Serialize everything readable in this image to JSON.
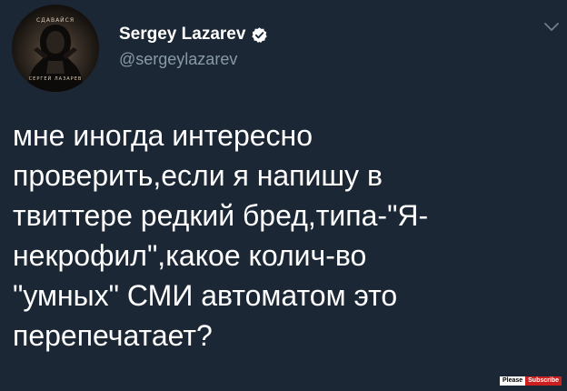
{
  "author": {
    "display_name": "Sergey Lazarev",
    "handle": "@sergeylazarev",
    "verified": true,
    "avatar_caption_top": "СДАВАЙСЯ",
    "avatar_caption_bottom": "СЕРГЕЙ ЛАЗАРЕВ"
  },
  "tweet": {
    "text": "мне иногда интересно\nпроверить,если я напишу в\nтвиттере редкий бред,типа-\"Я-\nнекрофил\",какое колич-во\n\"умных\" СМИ автоматом это\nперепечатает?"
  },
  "watermark": {
    "left": "Please",
    "right": "Subscribe"
  },
  "colors": {
    "background": "#1c2735",
    "handle": "#8899a6",
    "verified": "#ffffff"
  },
  "icons": {
    "verified": "verified-badge-icon",
    "menu": "chevron-down-icon"
  }
}
